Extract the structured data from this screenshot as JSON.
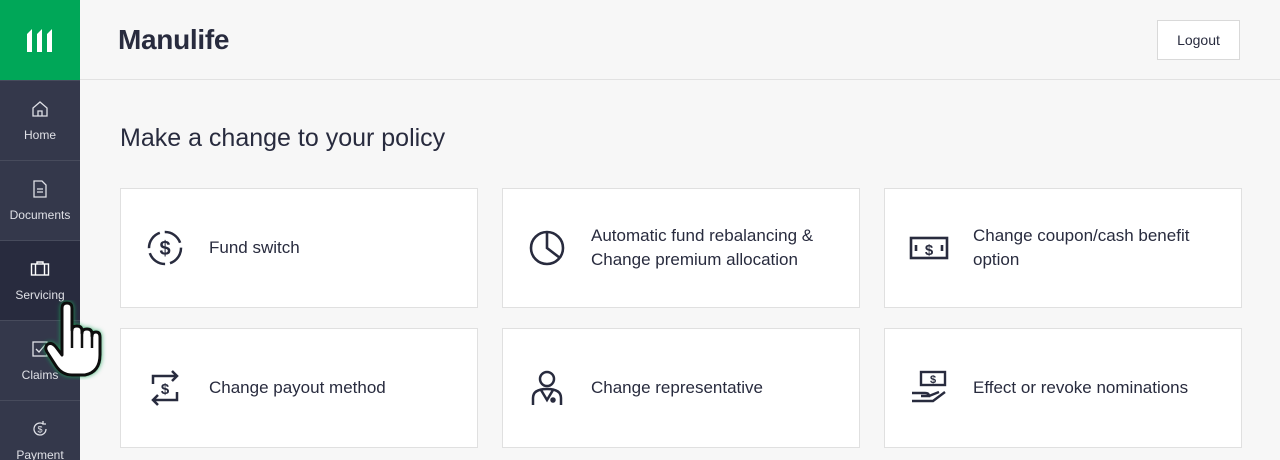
{
  "brand": {
    "name": "Manulife"
  },
  "header": {
    "logout_label": "Logout"
  },
  "sidebar": {
    "items": [
      {
        "label": "Home",
        "icon": "home-icon"
      },
      {
        "label": "Documents",
        "icon": "document-icon"
      },
      {
        "label": "Servicing",
        "icon": "briefcase-icon",
        "active": true
      },
      {
        "label": "Claims",
        "icon": "check-square-icon"
      },
      {
        "label": "Payment",
        "icon": "payment-icon"
      }
    ]
  },
  "main": {
    "title": "Make a change to your policy",
    "cards": [
      {
        "label": "Fund switch",
        "icon": "dollar-circle-icon"
      },
      {
        "label": "Automatic fund rebalancing & Change premium allocation",
        "icon": "pie-chart-icon"
      },
      {
        "label": "Change coupon/cash benefit option",
        "icon": "banknote-icon"
      },
      {
        "label": "Change payout method",
        "icon": "exchange-dollar-icon"
      },
      {
        "label": "Change representative",
        "icon": "representative-icon"
      },
      {
        "label": "Effect or revoke nominations",
        "icon": "hand-money-icon"
      }
    ]
  },
  "colors": {
    "brand_green": "#00a758",
    "sidebar_bg": "#34384b",
    "sidebar_active": "#282b3e",
    "text": "#282b3e"
  }
}
